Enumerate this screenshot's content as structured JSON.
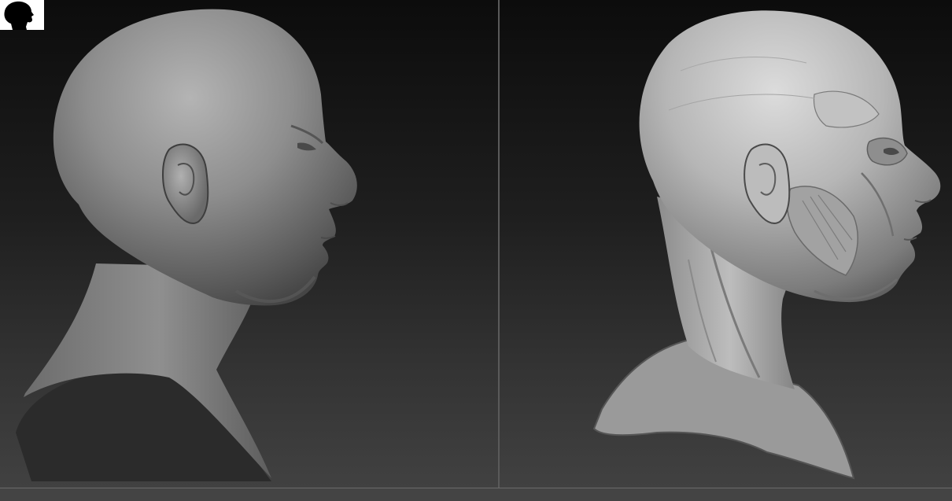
{
  "app": {
    "logo_icon": "head-silhouette-icon"
  },
  "viewports": [
    {
      "name": "skin-sculpt-view",
      "model": "head-skin-sculpt",
      "facing": "right"
    },
    {
      "name": "ecorche-sculpt-view",
      "model": "head-muscle-ecorche",
      "facing": "right"
    }
  ],
  "colors": {
    "background_top": "#0c0c0c",
    "background_bottom": "#414141",
    "clay_dark": "#5e5e5e",
    "clay_mid": "#8a8a8a",
    "clay_light": "#c9c9c9",
    "divider": "#5a5a5a"
  }
}
